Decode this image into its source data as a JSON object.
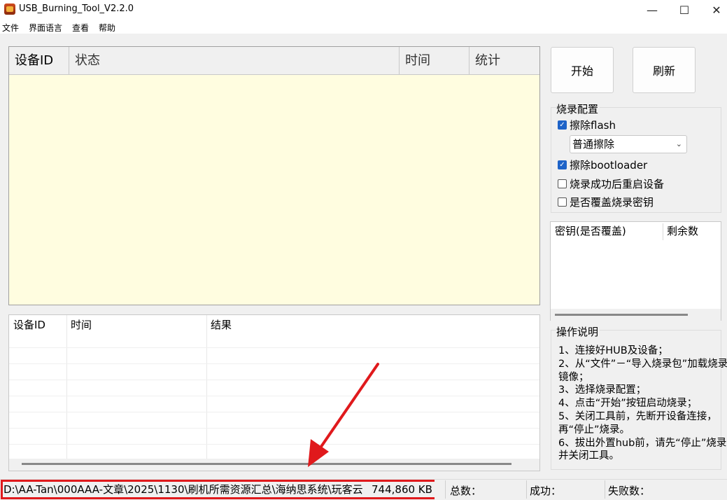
{
  "window": {
    "title": "USB_Burning_Tool_V2.2.0",
    "controls": {
      "minimize": "—",
      "maximize": "☐",
      "close": "✕"
    }
  },
  "menu": [
    "文件",
    "界面语言",
    "查看",
    "帮助"
  ],
  "device_table": {
    "columns": [
      "设备ID",
      "状态",
      "时间",
      "统计"
    ],
    "rows": []
  },
  "log_table": {
    "columns": [
      "设备ID",
      "时间",
      "结果"
    ],
    "rows": []
  },
  "buttons": {
    "start": "开始",
    "refresh": "刷新"
  },
  "burn_config": {
    "title": "烧录配置",
    "erase_flash": {
      "label": "擦除flash",
      "checked": true
    },
    "erase_mode": {
      "selected": "普通擦除"
    },
    "erase_bootloader": {
      "label": "擦除bootloader",
      "checked": true
    },
    "reboot_after": {
      "label": "烧录成功后重启设备",
      "checked": false
    },
    "overwrite_key": {
      "label": "是否覆盖烧录密钥",
      "checked": false
    }
  },
  "key_table": {
    "columns": [
      "密钥(是否覆盖)",
      "剩余数"
    ]
  },
  "instructions": {
    "title": "操作说明",
    "text": "1、连接好HUB及设备；\n2、从“文件”－“导入烧录包”加载烧录镜像；\n3、选择烧录配置；\n4、点击“开始”按钮启动烧录；\n5、关闭工具前，先断开设备连接，再“停止”烧录。\n6、拔出外置hub前，请先“停止”烧录并关闭工具。"
  },
  "status_bar": {
    "path": "D:\\AA-Tan\\000AAA-文章\\2025\\1130\\刷机所需资源汇总\\海纳思系统\\玩客云",
    "size": "744,860 KB",
    "total_label": "总数：",
    "success_label": "成功：",
    "fail_label": "失败数："
  },
  "colors": {
    "highlight": "#e0191c",
    "table_bg": "#fffde0",
    "checkbox": "#1e63c8"
  }
}
